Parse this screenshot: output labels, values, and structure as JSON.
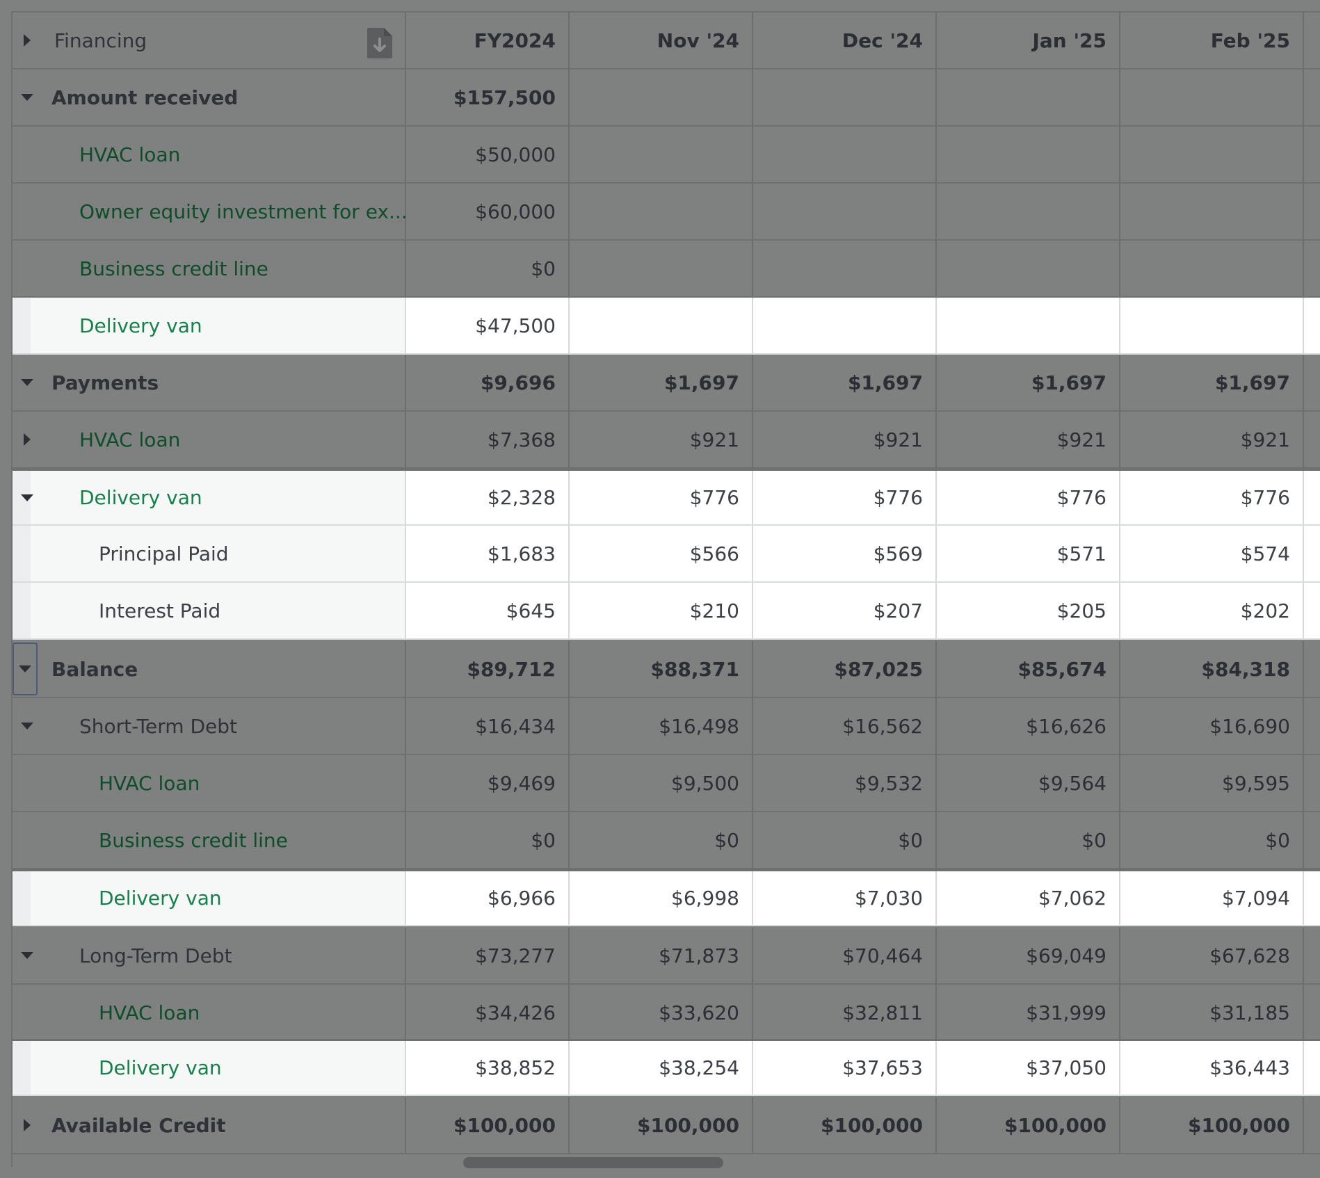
{
  "header": {
    "title": "Financing",
    "columns": [
      "FY2024",
      "Nov '24",
      "Dec '24",
      "Jan '25",
      "Feb '25"
    ],
    "export_icon": "file-download-icon"
  },
  "rows": [
    {
      "label": "Amount received",
      "values": [
        "$157,500",
        "",
        "",
        "",
        ""
      ]
    },
    {
      "label": "HVAC loan",
      "values": [
        "$50,000",
        "",
        "",
        "",
        ""
      ]
    },
    {
      "label": "Owner equity investment for ex...",
      "values": [
        "$60,000",
        "",
        "",
        "",
        ""
      ]
    },
    {
      "label": "Business credit line",
      "values": [
        "$0",
        "",
        "",
        "",
        ""
      ]
    },
    {
      "label": "Delivery van",
      "values": [
        "$47,500",
        "",
        "",
        "",
        ""
      ]
    },
    {
      "label": "Payments",
      "values": [
        "$9,696",
        "$1,697",
        "$1,697",
        "$1,697",
        "$1,697"
      ]
    },
    {
      "label": "HVAC loan",
      "values": [
        "$7,368",
        "$921",
        "$921",
        "$921",
        "$921"
      ]
    },
    {
      "label": "Delivery van",
      "values": [
        "$2,328",
        "$776",
        "$776",
        "$776",
        "$776"
      ]
    },
    {
      "label": "Principal Paid",
      "values": [
        "$1,683",
        "$566",
        "$569",
        "$571",
        "$574"
      ]
    },
    {
      "label": "Interest Paid",
      "values": [
        "$645",
        "$210",
        "$207",
        "$205",
        "$202"
      ]
    },
    {
      "label": "Balance",
      "values": [
        "$89,712",
        "$88,371",
        "$87,025",
        "$85,674",
        "$84,318"
      ]
    },
    {
      "label": "Short-Term Debt",
      "values": [
        "$16,434",
        "$16,498",
        "$16,562",
        "$16,626",
        "$16,690"
      ]
    },
    {
      "label": "HVAC loan",
      "values": [
        "$9,469",
        "$9,500",
        "$9,532",
        "$9,564",
        "$9,595"
      ]
    },
    {
      "label": "Business credit line",
      "values": [
        "$0",
        "$0",
        "$0",
        "$0",
        "$0"
      ]
    },
    {
      "label": "Delivery van",
      "values": [
        "$6,966",
        "$6,998",
        "$7,030",
        "$7,062",
        "$7,094"
      ]
    },
    {
      "label": "Long-Term Debt",
      "values": [
        "$73,277",
        "$71,873",
        "$70,464",
        "$69,049",
        "$67,628"
      ]
    },
    {
      "label": "HVAC loan",
      "values": [
        "$34,426",
        "$33,620",
        "$32,811",
        "$31,999",
        "$31,185"
      ]
    },
    {
      "label": "Delivery van",
      "values": [
        "$38,852",
        "$38,254",
        "$37,653",
        "$37,050",
        "$36,443"
      ]
    },
    {
      "label": "Available Credit",
      "values": [
        "$100,000",
        "$100,000",
        "$100,000",
        "$100,000",
        "$100,000"
      ]
    }
  ],
  "colors": {
    "background": "#7f8080",
    "highlight_row": "#ffffff",
    "link_green": "#17804a",
    "dim_green": "#0f4d2a"
  }
}
